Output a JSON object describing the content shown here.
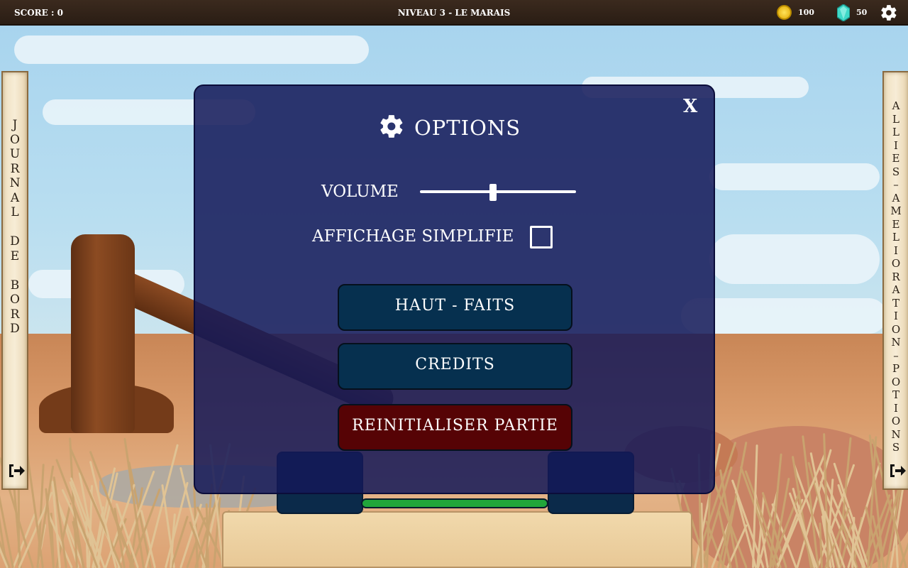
{
  "topbar": {
    "score": "SCORE : 0",
    "level": "NIVEAU 3 - LE MARAIS",
    "coins": "100",
    "gems": "50"
  },
  "left_panel": {
    "label": "J\nO\nU\nR\nN\nA\nL\n\nD\nE\n\nB\nO\nR\nD"
  },
  "right_panel": {
    "label": "A\nL\nL\nI\nE\nS\n–\nA\nM\nE\nL\nI\nO\nR\nA\nT\nI\nO\nN\n–\nP\nO\nT\nI\nO\nN\nS"
  },
  "options": {
    "close": "X",
    "title": "OPTIONS",
    "volume_label": "VOLUME",
    "volume_value": 0.47,
    "simple_display_label": "AFFICHAGE SIMPLIFIE",
    "simple_display_checked": false,
    "achievements_button": "HAUT - FAITS",
    "credits_button": "CREDITS",
    "reset_button": "REINITIALISER PARTIE"
  },
  "hud": {
    "progress": 1.0
  },
  "icons": [
    "coin-icon",
    "gem-icon",
    "gear-icon",
    "exit-icon",
    "close-icon"
  ],
  "colors": {
    "dialog_bg": "#14185a",
    "button_blue": "#06304f",
    "button_red": "#560305",
    "progress_green": "#21a63a",
    "coin": "#f5c400",
    "gem": "#3fd9c8"
  }
}
